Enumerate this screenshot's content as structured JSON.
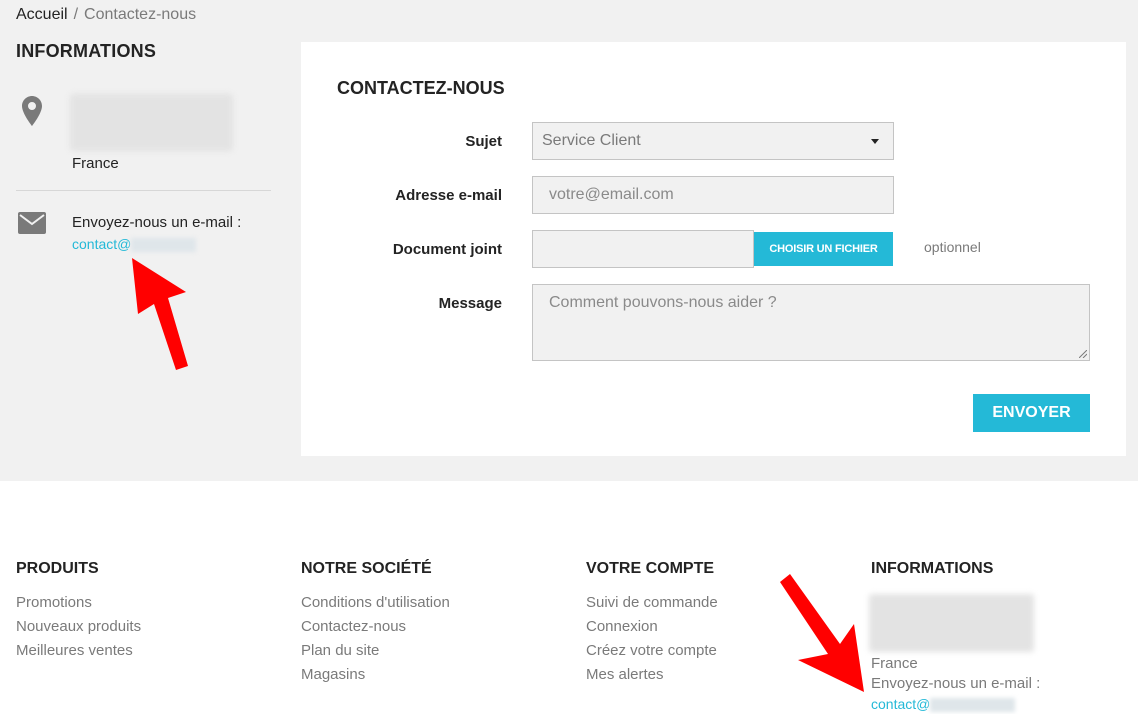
{
  "breadcrumb": {
    "home": "Accueil",
    "separator": "/",
    "current": "Contactez-nous"
  },
  "sidebar": {
    "title": "INFORMATIONS",
    "country": "France",
    "mail_label": "Envoyez-nous un e-mail :",
    "mail_link": "contact@"
  },
  "form": {
    "title": "CONTACTEZ-NOUS",
    "subject_label": "Sujet",
    "subject_value": "Service Client",
    "email_label": "Adresse e-mail",
    "email_placeholder": "votre@email.com",
    "file_label": "Document joint",
    "file_button": "CHOISIR UN FICHIER",
    "file_optional": "optionnel",
    "message_label": "Message",
    "message_placeholder": "Comment pouvons-nous aider ?",
    "submit": "ENVOYER"
  },
  "footer": {
    "products": {
      "title": "PRODUITS",
      "links": [
        "Promotions",
        "Nouveaux produits",
        "Meilleures ventes"
      ]
    },
    "company": {
      "title": "NOTRE SOCIÉTÉ",
      "links": [
        "Conditions d'utilisation",
        "Contactez-nous",
        "Plan du site",
        "Magasins"
      ]
    },
    "account": {
      "title": "VOTRE COMPTE",
      "links": [
        "Suivi de commande",
        "Connexion",
        "Créez votre compte",
        "Mes alertes"
      ]
    },
    "info": {
      "title": "INFORMATIONS",
      "country": "France",
      "mail_label": "Envoyez-nous un e-mail :",
      "mail_link": "contact@"
    }
  },
  "colors": {
    "accent": "#24b9d7",
    "background": "#f1f1f1",
    "annotation_arrow": "#ff0000"
  },
  "icons": {
    "location": "location-pin-icon",
    "mail": "envelope-icon",
    "caret": "caret-down-icon"
  }
}
